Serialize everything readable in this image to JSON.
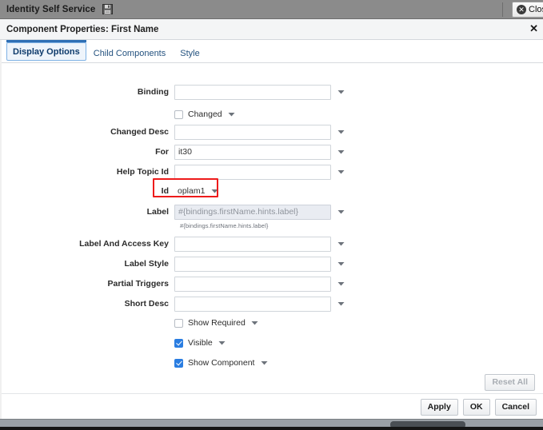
{
  "appbar": {
    "title": "Identity Self Service",
    "save_icon": "save-disk-icon",
    "close_label": "Close",
    "close_icon": "close-circle-icon"
  },
  "dialog": {
    "title": "Component Properties: First Name",
    "close_glyph": "✕"
  },
  "tabs": [
    {
      "label": "Display Options",
      "active": true
    },
    {
      "label": "Child Components",
      "active": false
    },
    {
      "label": "Style",
      "active": false
    }
  ],
  "fields": [
    {
      "label": "Binding",
      "value": "",
      "placeholder": "",
      "disabled": false
    },
    {
      "label": "Changed Desc",
      "value": "",
      "placeholder": "",
      "disabled": false
    },
    {
      "label": "For",
      "value": "it30",
      "placeholder": "",
      "disabled": false
    },
    {
      "label": "Help Topic Id",
      "value": "",
      "placeholder": "",
      "disabled": false
    },
    {
      "label": "Label",
      "value": "#{bindings.firstName.hints.label}",
      "placeholder": "",
      "disabled": true
    },
    {
      "label": "Label And Access Key",
      "value": "",
      "placeholder": "",
      "disabled": false
    },
    {
      "label": "Label Style",
      "value": "",
      "placeholder": "",
      "disabled": false
    },
    {
      "label": "Partial Triggers",
      "value": "",
      "placeholder": "",
      "disabled": false
    },
    {
      "label": "Short Desc",
      "value": "",
      "placeholder": "",
      "disabled": false
    }
  ],
  "id_field": {
    "label": "Id",
    "value": "oplam1",
    "highlighted": true,
    "highlight_color": "#ee1b1b"
  },
  "label_helper_text": "#{bindings.firstName.hints.label}",
  "checkboxes": [
    {
      "label": "Changed",
      "checked": false
    },
    {
      "label": "Show Required",
      "checked": false
    },
    {
      "label": "Visible",
      "checked": true
    },
    {
      "label": "Show Component",
      "checked": true
    }
  ],
  "footer": {
    "reset_all": "Reset All",
    "reset_all_disabled": true,
    "apply": "Apply",
    "ok": "OK",
    "cancel": "Cancel"
  },
  "colors": {
    "accent": "#2a7de1",
    "tab_active": "#2f6fb5",
    "annotation": "#ee1b1b",
    "appbar_bg": "#8b8b8b"
  }
}
